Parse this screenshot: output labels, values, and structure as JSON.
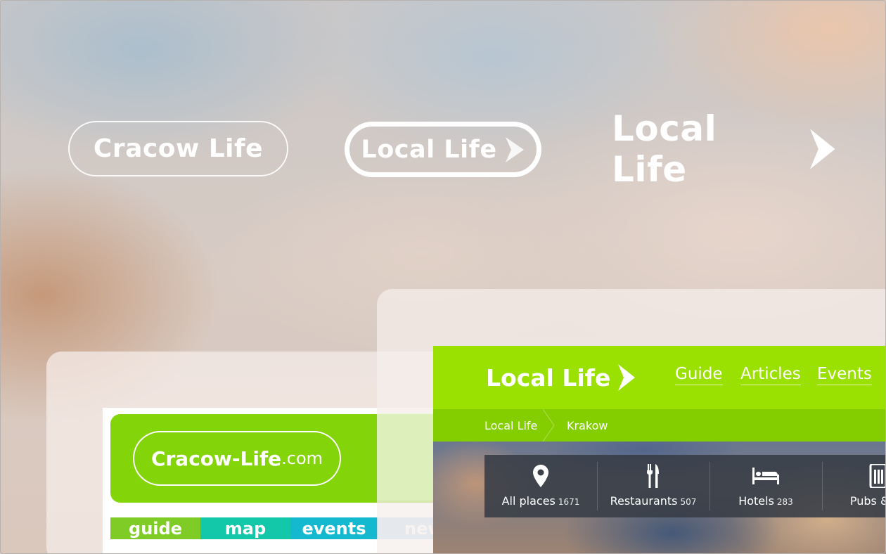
{
  "logos": {
    "cracow_life_pill": "Cracow Life",
    "local_life_pill": "Local Life",
    "local_life_plain": "Local Life"
  },
  "old_site": {
    "logo_main": "Cracow-Life",
    "logo_suffix": ".com",
    "nav": [
      "guide",
      "map",
      "events",
      "new"
    ]
  },
  "new_site": {
    "logo": "Local Life",
    "nav": [
      "Guide",
      "Articles",
      "Events"
    ],
    "breadcrumb": [
      "Local Life",
      "Krakow"
    ],
    "categories": [
      {
        "label": "All places",
        "count": "1671",
        "icon": "map-pin-icon"
      },
      {
        "label": "Restaurants",
        "count": "507",
        "icon": "fork-knife-icon"
      },
      {
        "label": "Hotels",
        "count": "283",
        "icon": "bed-icon"
      },
      {
        "label": "Pubs & Cl",
        "count": "",
        "icon": "beer-icon"
      }
    ]
  },
  "colors": {
    "brand_green": "#9ae000",
    "breadcrumb_green": "#84ce00",
    "old_green": "#84d40a"
  }
}
